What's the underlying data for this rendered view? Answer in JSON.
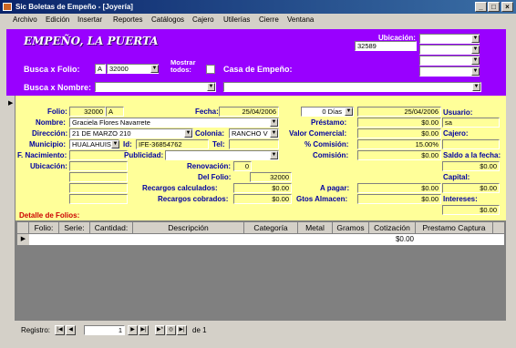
{
  "window": {
    "title": "Sic Boletas de Empeño - [Joyería]",
    "controls": [
      "_",
      "□",
      "×"
    ]
  },
  "menu": [
    "Archivo",
    "Edición",
    "Insertar",
    "Reportes",
    "Catálogos",
    "Cajero",
    "Utilerías",
    "Cierre",
    "Ventana"
  ],
  "header": {
    "brand": "EMPEÑO, LA PUERTA",
    "ubicacion_label": "Ubicación:",
    "ubicacion_value": "32589",
    "busca_folio_label": "Busca x Folio:",
    "folio_prefix": "A",
    "folio_value": "32000",
    "mostrar_todos_label": "Mostrar todos:",
    "casa_label": "Casa de Empeño:",
    "busca_nombre_label": "Busca x Nombre:"
  },
  "form": {
    "folio_label": "Folio:",
    "folio_num": "32000",
    "folio_suffix": "A",
    "fecha_label": "Fecha:",
    "fecha_value": "25/04/2006",
    "dias_value": "0 Días",
    "fecha2_value": "25/04/2006",
    "usuario_label": "Usuario:",
    "usuario_value": "sa",
    "nombre_label": "Nombre:",
    "nombre_value": "Graciela Flores Navarrete",
    "prestamo_label": "Préstamo:",
    "prestamo_value": "$0.00",
    "direccion_label": "Dirección:",
    "direccion_value": "21 DE MARZO 210",
    "colonia_label": "Colonia:",
    "colonia_value": "RANCHO V",
    "valor_label": "Valor Comercial:",
    "valor_value": "$0.00",
    "cajero_label": "Cajero:",
    "municipio_label": "Municipio:",
    "municipio_value": "HUALAHUISI",
    "id_label": "Id:",
    "id_value": "IFE-36854762",
    "tel_label": "Tel:",
    "comision_pct_label": "% Comisión:",
    "comision_pct_value": "15.00%",
    "fnac_label": "F. Nacimiento:",
    "publicidad_label": "Publicidad:",
    "comision_label": "Comisión:",
    "comision_value": "$0.00",
    "saldo_label": "Saldo a la fecha:",
    "saldo_value": "$0.00",
    "ubicacion_label": "Ubicación:",
    "renovacion_label": "Renovación:",
    "renovacion_value": "0",
    "delfolio_label": "Del Folio:",
    "delfolio_value": "32000",
    "capital_label": "Capital:",
    "recargos_calc_label": "Recargos calculados:",
    "recargos_calc_value": "$0.00",
    "apagar_label": "A pagar:",
    "apagar_value": "$0.00",
    "capital_value": "$0.00",
    "recargos_cob_label": "Recargos cobrados:",
    "recargos_cob_value": "$0.00",
    "gtos_label": "Gtos Almacen:",
    "gtos_value": "$0.00",
    "intereses_label": "Intereses:",
    "intereses_value": "$0.00",
    "detalle_label": "Detalle de Folios:"
  },
  "grid": {
    "columns": [
      "Folio:",
      "Serie:",
      "Cantidad:",
      "Descripción",
      "Categoría",
      "Metal",
      "Gramos",
      "Cotización",
      "Prestamo Captura"
    ],
    "row_cotizacion": "$0.00"
  },
  "status": {
    "registro_label": "Registro:",
    "current": "1",
    "of_label": "de 1"
  }
}
